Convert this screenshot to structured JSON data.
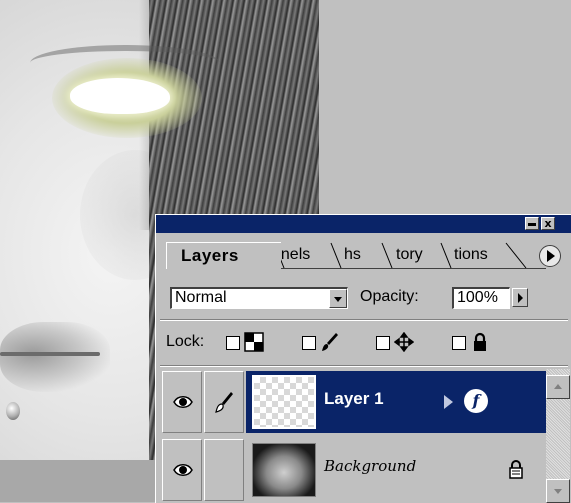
{
  "document": {
    "image_alt": "grayscale-portrait-glowing-eye"
  },
  "palette": {
    "tabs": [
      {
        "label": "Layers",
        "active": true
      },
      {
        "label": "nnels",
        "active": false
      },
      {
        "label": "hs",
        "active": false
      },
      {
        "label": "tory",
        "active": false
      },
      {
        "label": "tions",
        "active": false
      }
    ],
    "close_glyph": "x",
    "blend_mode": "Normal",
    "opacity_label": "Opacity:",
    "opacity_value": "100%",
    "lock_label": "Lock:",
    "lock_options": [
      {
        "icon": "transparency-lock-icon",
        "checked": false
      },
      {
        "icon": "brush-lock-icon",
        "checked": false
      },
      {
        "icon": "move-lock-icon",
        "checked": false
      },
      {
        "icon": "padlock-icon",
        "checked": false
      }
    ],
    "layers": [
      {
        "name": "Layer 1",
        "visible": true,
        "selected": true,
        "has_effects": true,
        "effects_glyph": "f",
        "locked": false
      },
      {
        "name": "Background",
        "visible": true,
        "selected": false,
        "has_effects": false,
        "locked": true
      }
    ],
    "colors": {
      "title_bar": "#0a2468",
      "selection": "#0a2468",
      "panel_bg": "#c0c0c0"
    }
  }
}
